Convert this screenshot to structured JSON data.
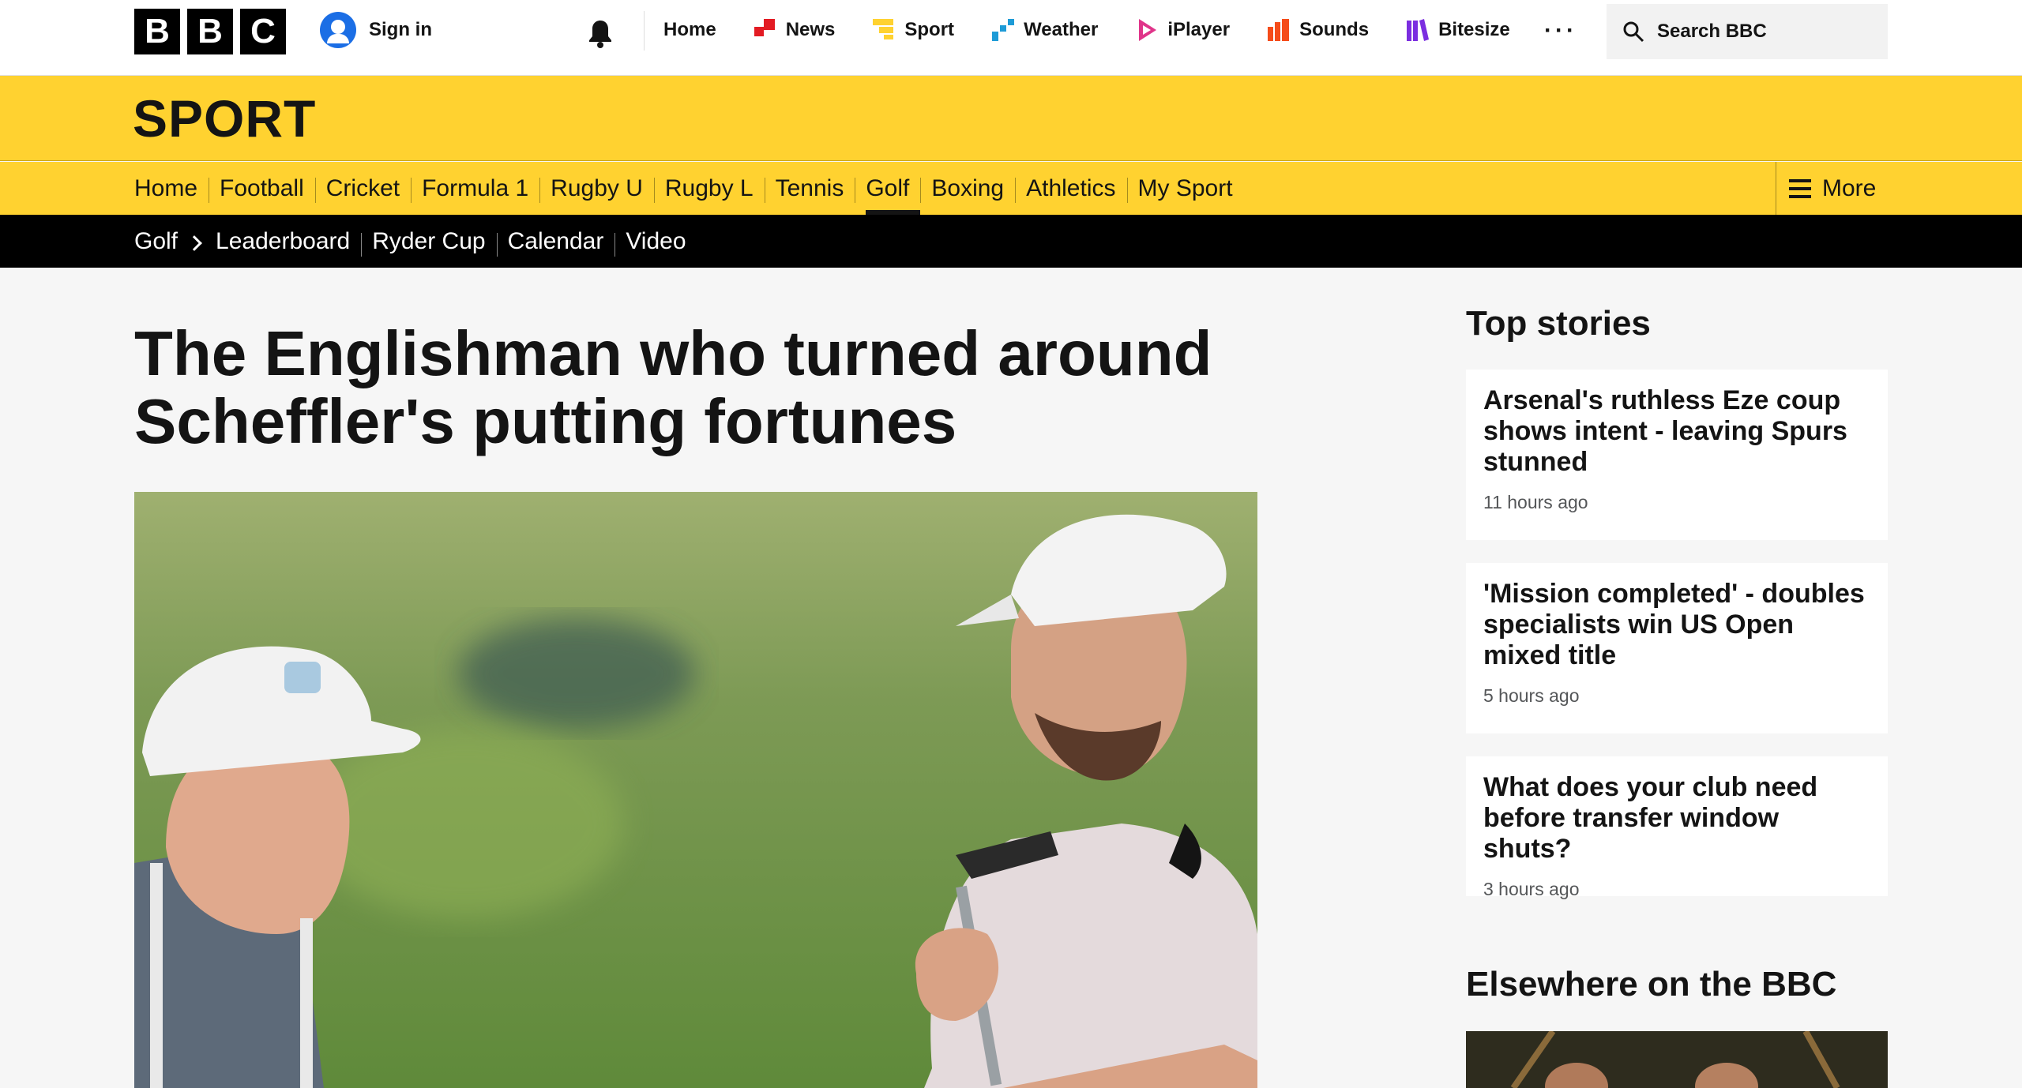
{
  "global": {
    "logo_letters": [
      "B",
      "B",
      "C"
    ],
    "sign_in": "Sign in",
    "nav": [
      {
        "label": "Home",
        "icon": "home-icon",
        "color": ""
      },
      {
        "label": "News",
        "icon": "news-icon",
        "color": "#e31b23"
      },
      {
        "label": "Sport",
        "icon": "sport-icon",
        "color": "#ffd230"
      },
      {
        "label": "Weather",
        "icon": "weather-icon",
        "color": "#1e9bd7"
      },
      {
        "label": "iPlayer",
        "icon": "iplayer-icon",
        "color": "#e0358a"
      },
      {
        "label": "Sounds",
        "icon": "sounds-icon",
        "color": "#f54c1a"
      },
      {
        "label": "Bitesize",
        "icon": "bitesize-icon",
        "color": "#7b2ee0"
      }
    ],
    "more_dots": "···",
    "search_placeholder": "Search BBC"
  },
  "sport": {
    "title": "SPORT",
    "nav": [
      "Home",
      "Football",
      "Cricket",
      "Formula 1",
      "Rugby U",
      "Rugby L",
      "Tennis",
      "Golf",
      "Boxing",
      "Athletics",
      "My Sport"
    ],
    "active": "Golf",
    "more": "More",
    "color": "#ffd230"
  },
  "subnav": {
    "section": "Golf",
    "items": [
      "Leaderboard",
      "Ryder Cup",
      "Calendar",
      "Video"
    ]
  },
  "article": {
    "headline": "The Englishman who turned around Scheffler's putting fortunes"
  },
  "sidebar": {
    "top_stories_title": "Top stories",
    "stories": [
      {
        "title": "Arsenal's ruthless Eze coup shows intent - leaving Spurs stunned",
        "time": "11 hours ago"
      },
      {
        "title": "'Mission completed' - doubles specialists win US Open mixed title",
        "time": "5 hours ago"
      },
      {
        "title": "What does your club need before transfer window shuts?",
        "time": "3 hours ago"
      }
    ],
    "elsewhere_title": "Elsewhere on the BBC"
  }
}
